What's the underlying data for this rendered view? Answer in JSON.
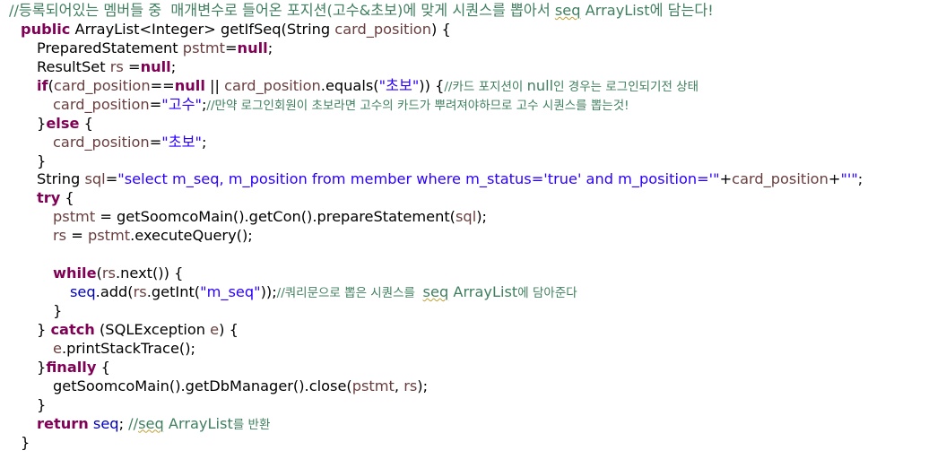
{
  "colors": {
    "background": "#ffffff",
    "comment": "#3f7f5f",
    "keyword": "#7f0055",
    "string": "#2a00ff",
    "field": "#0000c0",
    "local_variable": "#6a3e3e",
    "default": "#000000"
  },
  "lines": [
    {
      "indent": 0,
      "tokens": [
        {
          "t": "comment",
          "v": "//등록되어있는 멤버들 중  매개변수로 들어온 포지션(고수&초보)에 맞게 시퀀스를 뽑아서 "
        },
        {
          "t": "comment-squig",
          "v": "seq"
        },
        {
          "t": "comment",
          "v": " ArrayList에 담는다!"
        }
      ]
    },
    {
      "indent": 1,
      "tokens": [
        {
          "t": "kw",
          "v": "public"
        },
        {
          "t": "plain",
          "v": " ArrayList<Integer> getIfSeq(String "
        },
        {
          "t": "var",
          "v": "card_position"
        },
        {
          "t": "plain",
          "v": ") {"
        }
      ]
    },
    {
      "indent": 2,
      "tokens": [
        {
          "t": "plain",
          "v": "PreparedStatement "
        },
        {
          "t": "var",
          "v": "pstmt"
        },
        {
          "t": "plain",
          "v": "="
        },
        {
          "t": "kw",
          "v": "null"
        },
        {
          "t": "plain",
          "v": ";"
        }
      ]
    },
    {
      "indent": 2,
      "tokens": [
        {
          "t": "plain",
          "v": "ResultSet "
        },
        {
          "t": "var",
          "v": "rs"
        },
        {
          "t": "plain",
          "v": " ="
        },
        {
          "t": "kw",
          "v": "null"
        },
        {
          "t": "plain",
          "v": ";"
        }
      ]
    },
    {
      "indent": 2,
      "tokens": [
        {
          "t": "kw",
          "v": "if"
        },
        {
          "t": "plain",
          "v": "("
        },
        {
          "t": "var",
          "v": "card_position"
        },
        {
          "t": "plain",
          "v": "=="
        },
        {
          "t": "kw",
          "v": "null"
        },
        {
          "t": "plain",
          "v": " || "
        },
        {
          "t": "var",
          "v": "card_position"
        },
        {
          "t": "plain",
          "v": ".equals("
        },
        {
          "t": "str",
          "v": "\"초보\""
        },
        {
          "t": "plain",
          "v": ")) {"
        },
        {
          "t": "comment-small",
          "v": "//카드 포지션이 "
        },
        {
          "t": "comment",
          "v": "null"
        },
        {
          "t": "comment-small",
          "v": "인 경우는 로그인되기전 상태"
        }
      ]
    },
    {
      "indent": 3,
      "tokens": [
        {
          "t": "var",
          "v": "card_position"
        },
        {
          "t": "plain",
          "v": "="
        },
        {
          "t": "str",
          "v": "\"고수\""
        },
        {
          "t": "plain",
          "v": ";"
        },
        {
          "t": "comment-small",
          "v": "//만약 로그인회원이 초보라면 고수의 카드가 뿌려져야하므로 고수 시퀀스를 뽑는것!"
        }
      ]
    },
    {
      "indent": 2,
      "tokens": [
        {
          "t": "plain",
          "v": "}"
        },
        {
          "t": "kw",
          "v": "else"
        },
        {
          "t": "plain",
          "v": " {"
        }
      ]
    },
    {
      "indent": 3,
      "tokens": [
        {
          "t": "var",
          "v": "card_position"
        },
        {
          "t": "plain",
          "v": "="
        },
        {
          "t": "str",
          "v": "\"초보\""
        },
        {
          "t": "plain",
          "v": ";"
        }
      ]
    },
    {
      "indent": 2,
      "tokens": [
        {
          "t": "plain",
          "v": "}"
        }
      ]
    },
    {
      "indent": 2,
      "tokens": [
        {
          "t": "plain",
          "v": "String "
        },
        {
          "t": "var",
          "v": "sql"
        },
        {
          "t": "plain",
          "v": "="
        },
        {
          "t": "str",
          "v": "\"select m_seq, m_position from member where m_status='true' and m_position='\""
        },
        {
          "t": "plain",
          "v": "+"
        },
        {
          "t": "var",
          "v": "card_position"
        },
        {
          "t": "plain",
          "v": "+"
        },
        {
          "t": "str",
          "v": "\"'\""
        },
        {
          "t": "plain",
          "v": ";"
        }
      ]
    },
    {
      "indent": 2,
      "tokens": [
        {
          "t": "kw",
          "v": "try"
        },
        {
          "t": "plain",
          "v": " {"
        }
      ]
    },
    {
      "indent": 3,
      "tokens": [
        {
          "t": "var",
          "v": "pstmt"
        },
        {
          "t": "plain",
          "v": " = getSoomcoMain().getCon().prepareStatement("
        },
        {
          "t": "var",
          "v": "sql"
        },
        {
          "t": "plain",
          "v": ");"
        }
      ]
    },
    {
      "indent": 3,
      "tokens": [
        {
          "t": "var",
          "v": "rs"
        },
        {
          "t": "plain",
          "v": " = "
        },
        {
          "t": "var",
          "v": "pstmt"
        },
        {
          "t": "plain",
          "v": ".executeQuery();"
        }
      ]
    },
    {
      "indent": 3,
      "tokens": []
    },
    {
      "indent": 3,
      "tokens": [
        {
          "t": "kw",
          "v": "while"
        },
        {
          "t": "plain",
          "v": "("
        },
        {
          "t": "var",
          "v": "rs"
        },
        {
          "t": "plain",
          "v": ".next()) {"
        }
      ]
    },
    {
      "indent": 4,
      "tokens": [
        {
          "t": "field",
          "v": "seq"
        },
        {
          "t": "plain",
          "v": ".add("
        },
        {
          "t": "var",
          "v": "rs"
        },
        {
          "t": "plain",
          "v": ".getInt("
        },
        {
          "t": "str",
          "v": "\"m_seq\""
        },
        {
          "t": "plain",
          "v": "));"
        },
        {
          "t": "comment-small",
          "v": "//쿼리문으로 뽑은 시퀀스를  "
        },
        {
          "t": "comment-squig",
          "v": "seq"
        },
        {
          "t": "comment",
          "v": " ArrayList"
        },
        {
          "t": "comment-small",
          "v": "에 담아준다"
        }
      ]
    },
    {
      "indent": 3,
      "tokens": [
        {
          "t": "plain",
          "v": "}"
        }
      ]
    },
    {
      "indent": 2,
      "tokens": [
        {
          "t": "plain",
          "v": "} "
        },
        {
          "t": "kw",
          "v": "catch"
        },
        {
          "t": "plain",
          "v": " (SQLException "
        },
        {
          "t": "var",
          "v": "e"
        },
        {
          "t": "plain",
          "v": ") {"
        }
      ]
    },
    {
      "indent": 3,
      "tokens": [
        {
          "t": "var",
          "v": "e"
        },
        {
          "t": "plain",
          "v": ".printStackTrace();"
        }
      ]
    },
    {
      "indent": 2,
      "tokens": [
        {
          "t": "plain",
          "v": "}"
        },
        {
          "t": "kw",
          "v": "finally"
        },
        {
          "t": "plain",
          "v": " {"
        }
      ]
    },
    {
      "indent": 3,
      "tokens": [
        {
          "t": "plain",
          "v": "getSoomcoMain().getDbManager().close("
        },
        {
          "t": "var",
          "v": "pstmt"
        },
        {
          "t": "plain",
          "v": ", "
        },
        {
          "t": "var",
          "v": "rs"
        },
        {
          "t": "plain",
          "v": ");"
        }
      ]
    },
    {
      "indent": 2,
      "tokens": [
        {
          "t": "plain",
          "v": "}"
        }
      ]
    },
    {
      "indent": 2,
      "tokens": [
        {
          "t": "kw",
          "v": "return"
        },
        {
          "t": "plain",
          "v": " "
        },
        {
          "t": "field",
          "v": "seq"
        },
        {
          "t": "plain",
          "v": "; "
        },
        {
          "t": "comment",
          "v": "//"
        },
        {
          "t": "comment-squig",
          "v": "seq"
        },
        {
          "t": "comment",
          "v": " ArrayList"
        },
        {
          "t": "comment-small",
          "v": "를 반환"
        }
      ]
    },
    {
      "indent": 1,
      "tokens": [
        {
          "t": "plain",
          "v": "}"
        }
      ]
    }
  ]
}
